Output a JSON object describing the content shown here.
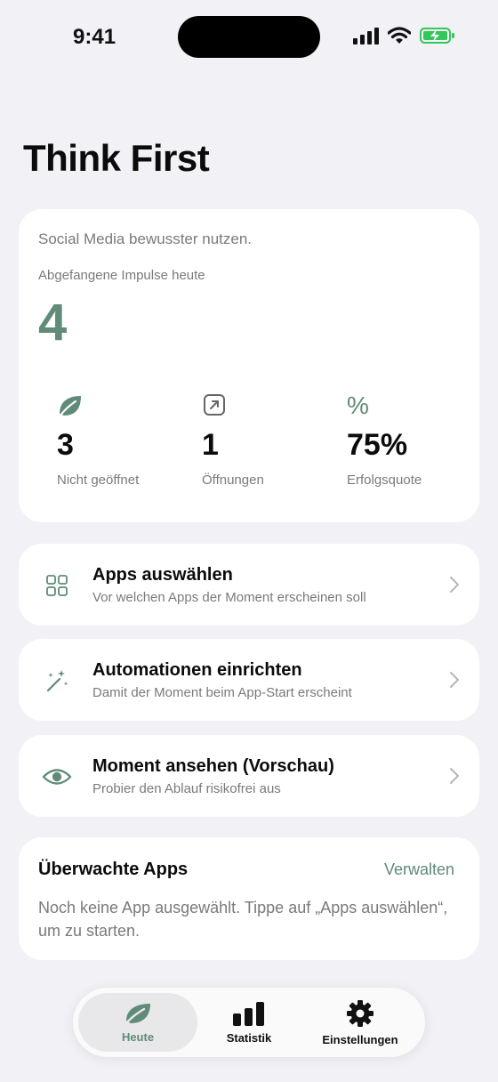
{
  "status_bar": {
    "time": "9:41",
    "icons": [
      "signal-icon",
      "wifi-icon",
      "battery-charging-icon"
    ]
  },
  "page": {
    "title": "Think First"
  },
  "hero": {
    "subtitle": "Social Media bewusster nutzen.",
    "label": "Abgefangene Impulse heute",
    "value": "4",
    "stats": [
      {
        "icon": "leaf-icon",
        "value": "3",
        "label": "Nicht geöffnet"
      },
      {
        "icon": "open-arrow-icon",
        "value": "1",
        "label": "Öffnungen"
      },
      {
        "icon": "percent-icon",
        "icon_glyph": "%",
        "value": "75%",
        "label": "Erfolgsquote"
      }
    ]
  },
  "actions": [
    {
      "icon": "grid-icon",
      "title": "Apps auswählen",
      "desc": "Vor welchen Apps der Moment erscheinen soll"
    },
    {
      "icon": "magic-wand-icon",
      "title": "Automationen einrichten",
      "desc": "Damit der Moment beim App-Start erscheint"
    },
    {
      "icon": "eye-icon",
      "title": "Moment ansehen (Vorschau)",
      "desc": "Probier den Ablauf risikofrei aus"
    }
  ],
  "watched": {
    "title": "Überwachte Apps",
    "manage": "Verwalten",
    "desc": "Noch keine App ausgewählt. Tippe auf „Apps auswählen“, um zu starten."
  },
  "tabbar": {
    "tabs": [
      {
        "icon": "leaf-icon",
        "label": "Heute",
        "active": true
      },
      {
        "icon": "bar-chart-icon",
        "label": "Statistik",
        "active": false
      },
      {
        "icon": "gear-icon",
        "label": "Einstellungen",
        "active": false
      }
    ]
  },
  "colors": {
    "accent": "#5f8b78",
    "background": "#f1f1f6",
    "card": "#ffffff",
    "secondary_text": "#7a7a7f",
    "battery": "#34c759"
  }
}
